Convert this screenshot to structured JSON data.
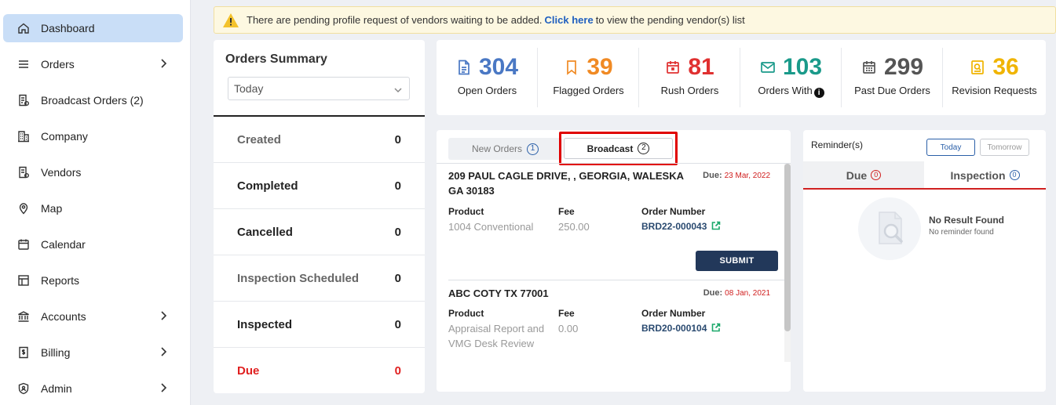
{
  "sidebar": {
    "items": [
      {
        "label": "Dashboard"
      },
      {
        "label": "Orders"
      },
      {
        "label": "Broadcast Orders (2)"
      },
      {
        "label": "Company"
      },
      {
        "label": "Vendors"
      },
      {
        "label": "Map"
      },
      {
        "label": "Calendar"
      },
      {
        "label": "Reports"
      },
      {
        "label": "Accounts"
      },
      {
        "label": "Billing"
      },
      {
        "label": "Admin"
      }
    ]
  },
  "alert": {
    "text_before": "There are pending profile request of vendors waiting to be added.",
    "link": "Click here",
    "text_after": "to view the pending vendor(s) list"
  },
  "summary": {
    "title": "Orders Summary",
    "period": "Today",
    "rows": [
      {
        "label": "Created",
        "value": "0"
      },
      {
        "label": "Completed",
        "value": "0"
      },
      {
        "label": "Cancelled",
        "value": "0"
      },
      {
        "label": "Inspection Scheduled",
        "value": "0"
      },
      {
        "label": "Inspected",
        "value": "0"
      },
      {
        "label": "Due",
        "value": "0"
      }
    ]
  },
  "stats": [
    {
      "value": "304",
      "label": "Open Orders",
      "color": "#4a78c4"
    },
    {
      "value": "39",
      "label": "Flagged Orders",
      "color": "#f08a24"
    },
    {
      "value": "81",
      "label": "Rush Orders",
      "color": "#e03030"
    },
    {
      "value": "103",
      "label": "Orders With",
      "color": "#1a9a8a"
    },
    {
      "value": "299",
      "label": "Past Due Orders",
      "color": "#555555"
    },
    {
      "value": "36",
      "label": "Revision Requests",
      "color": "#f0b400"
    }
  ],
  "order_tabs": {
    "new_label": "New Orders",
    "new_count": "1",
    "broadcast_label": "Broadcast",
    "broadcast_count": "2"
  },
  "order_cols": {
    "product": "Product",
    "fee": "Fee",
    "order_number": "Order Number"
  },
  "orders": [
    {
      "address": "209 PAUL CAGLE DRIVE, , GEORGIA, WALESKA GA 30183",
      "due_label": "Due:",
      "due_date": "23 Mar, 2022",
      "product": "1004 Conventional",
      "fee": "250.00",
      "order_number": "BRD22-000043",
      "submit": "SUBMIT"
    },
    {
      "address": "ABC COTY TX 77001",
      "due_label": "Due:",
      "due_date": "08 Jan, 2021",
      "product": "Appraisal Report and VMG Desk Review",
      "fee": "0.00",
      "order_number": "BRD20-000104"
    }
  ],
  "reminders": {
    "title": "Reminder(s)",
    "today": "Today",
    "tomorrow": "Tomorrow",
    "due_tab": "Due",
    "due_count": "0",
    "inspection_tab": "Inspection",
    "inspection_count": "0",
    "empty_title": "No Result Found",
    "empty_sub": "No reminder found"
  }
}
